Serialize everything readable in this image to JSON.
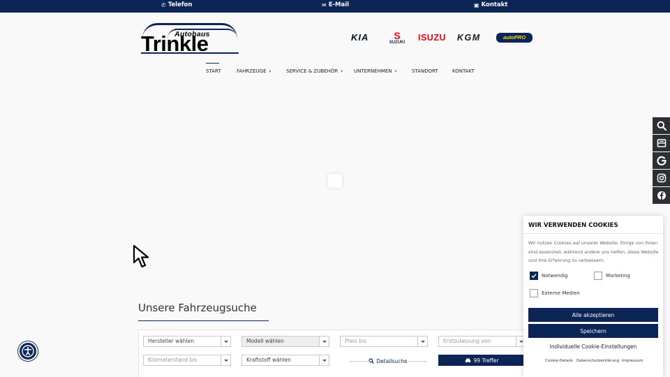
{
  "topbar": {
    "phone": "Telefon",
    "email": "E-Mail",
    "contact": "Kontakt"
  },
  "logo": {
    "line1": "Autohaus",
    "line2": "Trinkle"
  },
  "brands": {
    "kia": "KIA",
    "suzuki_mark": "S",
    "suzuki": "SUZUKI",
    "isuzu": "ISUZU",
    "kgm": "KGM",
    "autopro": "autoPRO"
  },
  "nav": {
    "start": "START",
    "fahrzeuge": "FAHRZEUGE",
    "service": "SERVICE & ZUBEHÖR",
    "unternehmen": "UNTERNEHMEN",
    "standort": "STANDORT",
    "kontakt": "KONTAKT"
  },
  "search": {
    "title": "Unsere Fahrzeugsuche",
    "hersteller": "Hersteller wählen",
    "modell": "Modell wählen",
    "preis": "Preis bis",
    "erstzulassung": "Erstzulassung von",
    "kilometer": "Kilometerstand bis",
    "kraftstoff": "Kraftstoff wählen",
    "detailsuche": "Detailsuche",
    "treffer": "99 Treffer"
  },
  "cookie": {
    "title": "WIR VERWENDEN COOKIES",
    "text": "Wir nutzen Cookies auf unserer Website. Einige von ihnen sind essenziell, während andere uns helfen, diese Website und Ihre Erfahrung zu verbessern.",
    "notwendig": "Notwendig",
    "marketing": "Marketing",
    "externe": "Externe Medien",
    "accept_all": "Alle akzeptieren",
    "save": "Speichern",
    "individual": "Individuelle Cookie-Einstellungen",
    "details": "Cookie-Details",
    "privacy": "Datenschutzerklärung",
    "imprint": "Impressum"
  },
  "colors": {
    "brand_navy": "#0c2557",
    "siderail": "#2d2f33"
  },
  "icons": {
    "siderail": [
      "search-icon",
      "mailbox-icon",
      "google-icon",
      "instagram-icon",
      "facebook-icon"
    ]
  }
}
